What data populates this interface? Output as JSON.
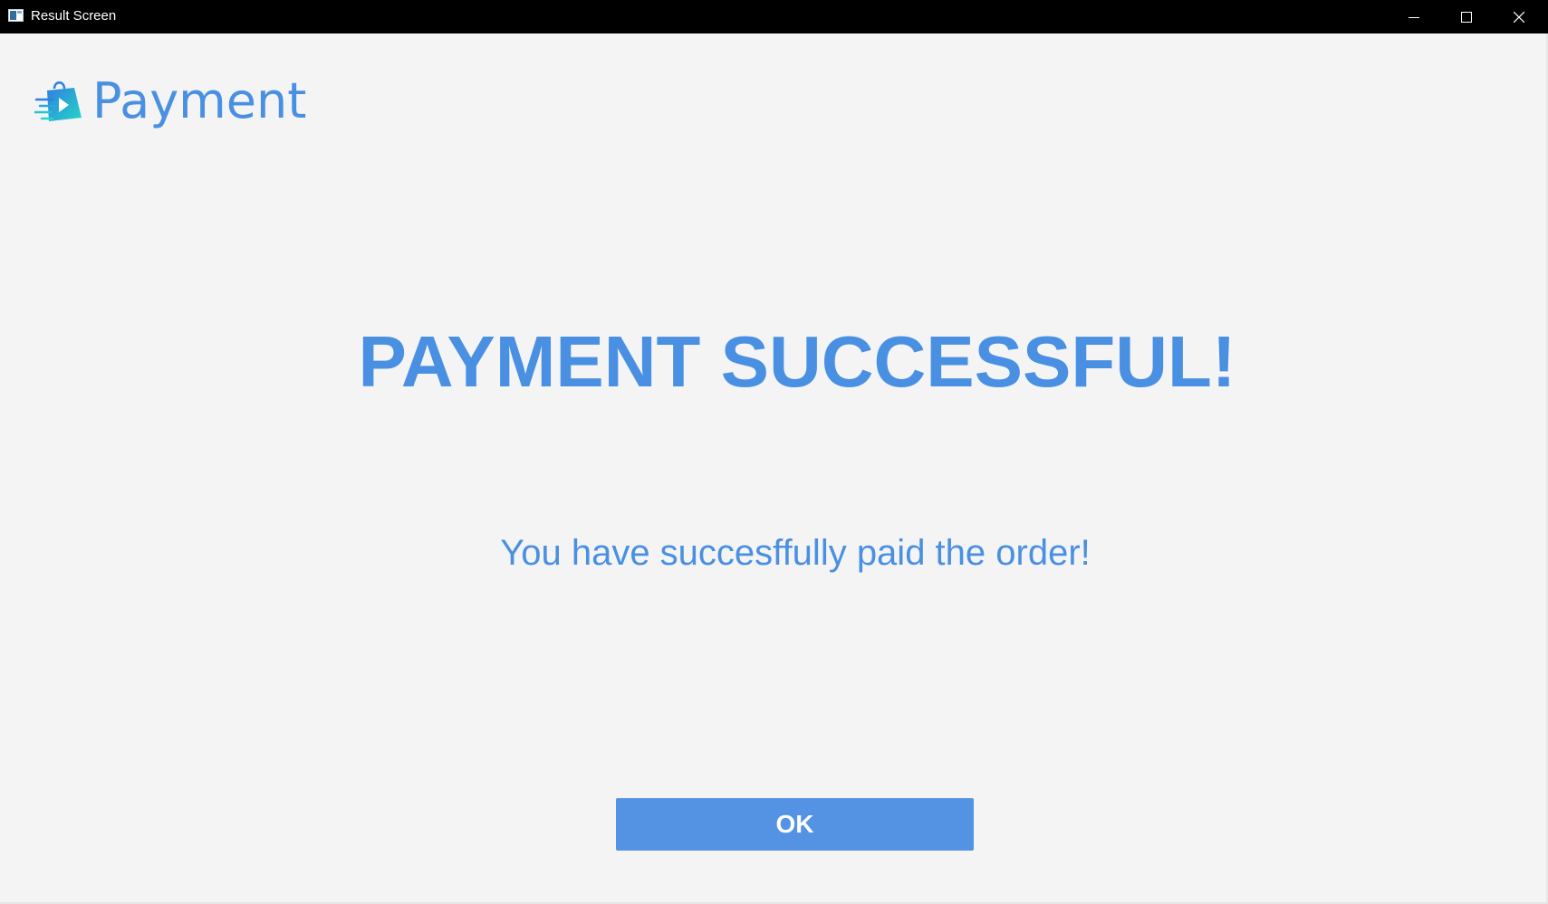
{
  "window": {
    "title": "Result Screen",
    "controls": {
      "minimize_icon": "minimize-icon",
      "maximize_icon": "maximize-icon",
      "close_icon": "close-icon"
    }
  },
  "brand": {
    "name": "Payment",
    "icon": "shopping-bag-play-icon",
    "color": "#4a90e2"
  },
  "result": {
    "headline": "PAYMENT SUCCESSFUL!",
    "message": "You have succesffully paid the order!"
  },
  "actions": {
    "ok_label": "OK",
    "ok_color": "#5493e3"
  }
}
